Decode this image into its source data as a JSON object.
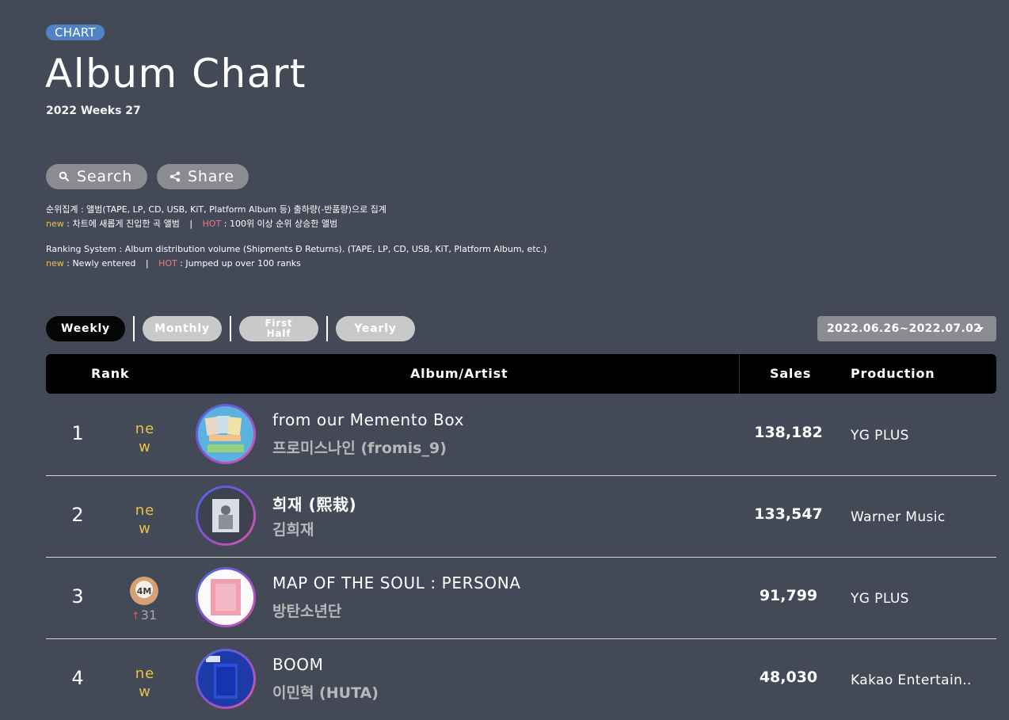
{
  "badge": "CHART",
  "title": "Album Chart",
  "week": "2022 Weeks 27",
  "buttons": {
    "search": "Search",
    "share": "Share"
  },
  "notes": {
    "ko_system": "순위집계 : 앨범(TAPE, LP, CD, USB, KiT, Platform Album 등) 출하량(-반품량)으로 집계",
    "ko_new_tag": "new",
    "ko_new_text": " : 차트에 새롭게 진입한 곡 앨범",
    "ko_sep": "|",
    "ko_hot_tag": "HOT",
    "ko_hot_text": " : 100위 이상 순위 상승한 앨범",
    "en_system": "Ranking System : Album distribution volume (Shipments Ð Returns). (TAPE, LP, CD, USB, KiT, Platform Album, etc.)",
    "en_new_tag": "new",
    "en_new_text": " : Newly entered",
    "en_sep": "|",
    "en_hot_tag": "HOT",
    "en_hot_text": " : Jumped up over 100 ranks"
  },
  "periods": {
    "weekly": "Weekly",
    "monthly": "Monthly",
    "first_half_1": "First",
    "first_half_2": "Half",
    "yearly": "Yearly",
    "active": "Weekly"
  },
  "date_range": "2022.06.26~2022.07.02",
  "columns": {
    "rank": "Rank",
    "album_artist": "Album/Artist",
    "sales": "Sales",
    "production": "Production"
  },
  "rows": [
    {
      "rank": "1",
      "status": "new",
      "album": "from our Memento Box",
      "artist": "프로미스나인 (fromis_9)",
      "sales": "138,182",
      "production": "YG PLUS"
    },
    {
      "rank": "2",
      "status": "new",
      "album": "희재 (熙栽)",
      "artist": "김희재",
      "sales": "133,547",
      "production": "Warner Music"
    },
    {
      "rank": "3",
      "medal": "4M",
      "change_arrow": "↑",
      "change": "31",
      "album": "MAP OF THE SOUL : PERSONA",
      "artist": "방탄소년단",
      "sales": "91,799",
      "production": "YG PLUS"
    },
    {
      "rank": "4",
      "status": "new",
      "album": "BOOM",
      "artist": "이민혁 (HUTA)",
      "sales": "48,030",
      "production": "Kakao Entertain.."
    }
  ],
  "colors": {
    "background": "#434957",
    "badge": "#4f83c4",
    "new": "#e8c34a",
    "hot": "#e97a8a",
    "up_arrow": "#e85a4f"
  }
}
